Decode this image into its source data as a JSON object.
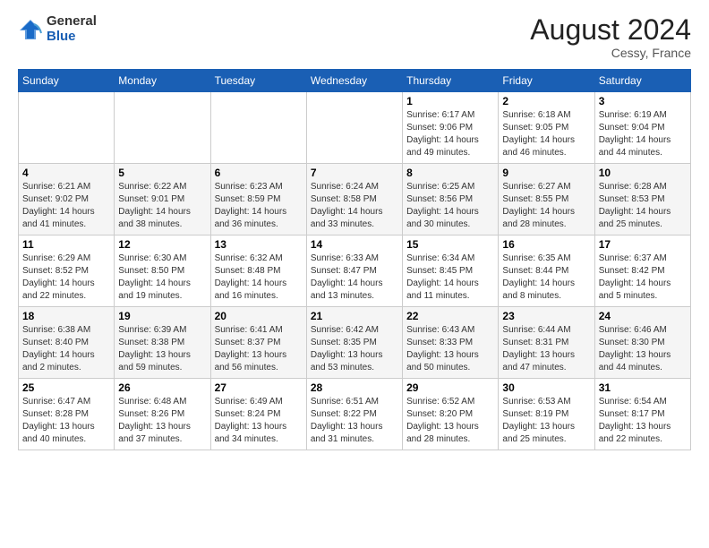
{
  "header": {
    "logo_general": "General",
    "logo_blue": "Blue",
    "month_year": "August 2024",
    "location": "Cessy, France"
  },
  "days_of_week": [
    "Sunday",
    "Monday",
    "Tuesday",
    "Wednesday",
    "Thursday",
    "Friday",
    "Saturday"
  ],
  "weeks": [
    [
      {
        "day": "",
        "info": ""
      },
      {
        "day": "",
        "info": ""
      },
      {
        "day": "",
        "info": ""
      },
      {
        "day": "",
        "info": ""
      },
      {
        "day": "1",
        "info": "Sunrise: 6:17 AM\nSunset: 9:06 PM\nDaylight: 14 hours\nand 49 minutes."
      },
      {
        "day": "2",
        "info": "Sunrise: 6:18 AM\nSunset: 9:05 PM\nDaylight: 14 hours\nand 46 minutes."
      },
      {
        "day": "3",
        "info": "Sunrise: 6:19 AM\nSunset: 9:04 PM\nDaylight: 14 hours\nand 44 minutes."
      }
    ],
    [
      {
        "day": "4",
        "info": "Sunrise: 6:21 AM\nSunset: 9:02 PM\nDaylight: 14 hours\nand 41 minutes."
      },
      {
        "day": "5",
        "info": "Sunrise: 6:22 AM\nSunset: 9:01 PM\nDaylight: 14 hours\nand 38 minutes."
      },
      {
        "day": "6",
        "info": "Sunrise: 6:23 AM\nSunset: 8:59 PM\nDaylight: 14 hours\nand 36 minutes."
      },
      {
        "day": "7",
        "info": "Sunrise: 6:24 AM\nSunset: 8:58 PM\nDaylight: 14 hours\nand 33 minutes."
      },
      {
        "day": "8",
        "info": "Sunrise: 6:25 AM\nSunset: 8:56 PM\nDaylight: 14 hours\nand 30 minutes."
      },
      {
        "day": "9",
        "info": "Sunrise: 6:27 AM\nSunset: 8:55 PM\nDaylight: 14 hours\nand 28 minutes."
      },
      {
        "day": "10",
        "info": "Sunrise: 6:28 AM\nSunset: 8:53 PM\nDaylight: 14 hours\nand 25 minutes."
      }
    ],
    [
      {
        "day": "11",
        "info": "Sunrise: 6:29 AM\nSunset: 8:52 PM\nDaylight: 14 hours\nand 22 minutes."
      },
      {
        "day": "12",
        "info": "Sunrise: 6:30 AM\nSunset: 8:50 PM\nDaylight: 14 hours\nand 19 minutes."
      },
      {
        "day": "13",
        "info": "Sunrise: 6:32 AM\nSunset: 8:48 PM\nDaylight: 14 hours\nand 16 minutes."
      },
      {
        "day": "14",
        "info": "Sunrise: 6:33 AM\nSunset: 8:47 PM\nDaylight: 14 hours\nand 13 minutes."
      },
      {
        "day": "15",
        "info": "Sunrise: 6:34 AM\nSunset: 8:45 PM\nDaylight: 14 hours\nand 11 minutes."
      },
      {
        "day": "16",
        "info": "Sunrise: 6:35 AM\nSunset: 8:44 PM\nDaylight: 14 hours\nand 8 minutes."
      },
      {
        "day": "17",
        "info": "Sunrise: 6:37 AM\nSunset: 8:42 PM\nDaylight: 14 hours\nand 5 minutes."
      }
    ],
    [
      {
        "day": "18",
        "info": "Sunrise: 6:38 AM\nSunset: 8:40 PM\nDaylight: 14 hours\nand 2 minutes."
      },
      {
        "day": "19",
        "info": "Sunrise: 6:39 AM\nSunset: 8:38 PM\nDaylight: 13 hours\nand 59 minutes."
      },
      {
        "day": "20",
        "info": "Sunrise: 6:41 AM\nSunset: 8:37 PM\nDaylight: 13 hours\nand 56 minutes."
      },
      {
        "day": "21",
        "info": "Sunrise: 6:42 AM\nSunset: 8:35 PM\nDaylight: 13 hours\nand 53 minutes."
      },
      {
        "day": "22",
        "info": "Sunrise: 6:43 AM\nSunset: 8:33 PM\nDaylight: 13 hours\nand 50 minutes."
      },
      {
        "day": "23",
        "info": "Sunrise: 6:44 AM\nSunset: 8:31 PM\nDaylight: 13 hours\nand 47 minutes."
      },
      {
        "day": "24",
        "info": "Sunrise: 6:46 AM\nSunset: 8:30 PM\nDaylight: 13 hours\nand 44 minutes."
      }
    ],
    [
      {
        "day": "25",
        "info": "Sunrise: 6:47 AM\nSunset: 8:28 PM\nDaylight: 13 hours\nand 40 minutes."
      },
      {
        "day": "26",
        "info": "Sunrise: 6:48 AM\nSunset: 8:26 PM\nDaylight: 13 hours\nand 37 minutes."
      },
      {
        "day": "27",
        "info": "Sunrise: 6:49 AM\nSunset: 8:24 PM\nDaylight: 13 hours\nand 34 minutes."
      },
      {
        "day": "28",
        "info": "Sunrise: 6:51 AM\nSunset: 8:22 PM\nDaylight: 13 hours\nand 31 minutes."
      },
      {
        "day": "29",
        "info": "Sunrise: 6:52 AM\nSunset: 8:20 PM\nDaylight: 13 hours\nand 28 minutes."
      },
      {
        "day": "30",
        "info": "Sunrise: 6:53 AM\nSunset: 8:19 PM\nDaylight: 13 hours\nand 25 minutes."
      },
      {
        "day": "31",
        "info": "Sunrise: 6:54 AM\nSunset: 8:17 PM\nDaylight: 13 hours\nand 22 minutes."
      }
    ]
  ]
}
